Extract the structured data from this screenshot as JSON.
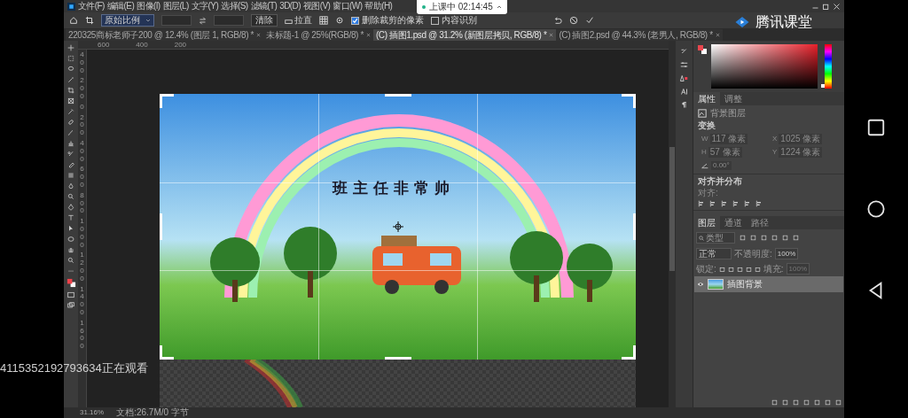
{
  "menu_bar": {
    "items": [
      "文件(F)",
      "编辑(E)",
      "图像(I)",
      "图层(L)",
      "文字(Y)",
      "选择(S)",
      "滤镜(T)",
      "3D(D)",
      "视图(V)",
      "窗口(W)",
      "帮助(H)"
    ]
  },
  "options_bar": {
    "ratio": "原始比例",
    "clear": "清除",
    "straighten": "拉直",
    "options": [
      {
        "label": "删除裁剪的像素",
        "checked": true
      },
      {
        "label": "内容识别",
        "checked": false
      }
    ]
  },
  "tabs": [
    {
      "label": "220325商标老师子200 @ 12.4% (图层 1, RGB/8) *",
      "selected": false
    },
    {
      "label": "未标题-1 @ 25%(RGB/8) *",
      "selected": false
    },
    {
      "label": "(C) 插图1.psd @ 31.2% (新图层拷贝, RGB/8) *",
      "selected": true
    },
    {
      "label": "(C) 插图2.psd @ 44.3% (老男人, RGB/8) *",
      "selected": false
    }
  ],
  "top_ruler": [
    "600",
    "400",
    "200"
  ],
  "left_ruler": [
    "400",
    "200",
    "0",
    "200",
    "400",
    "600",
    "800",
    "1000",
    "1200",
    "1400",
    "1600"
  ],
  "canvas": {
    "headline": "班主任非常帅"
  },
  "color_picker": {
    "hue": {
      "level": 0.02
    }
  },
  "properties": {
    "tabs": [
      {
        "label": "属性",
        "selected": true
      },
      {
        "label": "调整",
        "selected": false
      }
    ],
    "layer_kind": "背景图层",
    "transform_title": "变换",
    "fields": [
      {
        "label": "W",
        "value": "117 像素"
      },
      {
        "label": "X",
        "value": "1025 像素"
      },
      {
        "label": "H",
        "value": "57 像素"
      },
      {
        "label": "Y",
        "value": "1224 像素"
      }
    ],
    "angle": "0.00°",
    "align_title": "对齐并分布",
    "align_label": "对齐:"
  },
  "layers": {
    "tabs": [
      {
        "label": "图层",
        "selected": true
      },
      {
        "label": "通道",
        "selected": false
      },
      {
        "label": "路径",
        "selected": false
      }
    ],
    "filter": "类型",
    "blend": "正常",
    "opacity_label": "不透明度:",
    "opacity": "100%",
    "lock_label": "锁定:",
    "fill_label": "填充:",
    "fill": "100%",
    "items": [
      {
        "name": "插图背景",
        "visible": true,
        "selected": true
      }
    ]
  },
  "status_bar": {
    "zoom": "31.16%",
    "doc": "文档:26.7M/0 字节"
  },
  "overlay": {
    "live_badge": "上课中 02:14:45",
    "brand": "腾讯课堂",
    "viewer": "4115352192793634正在观看"
  }
}
